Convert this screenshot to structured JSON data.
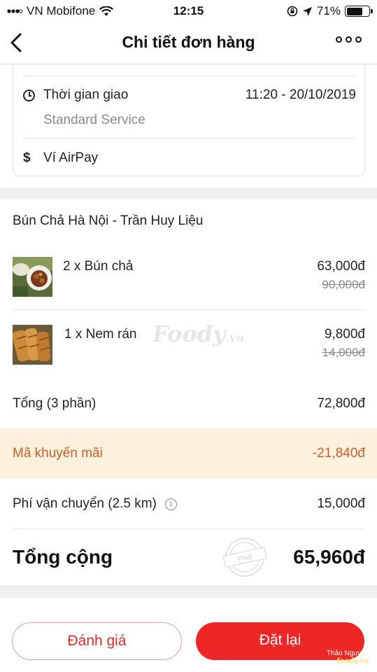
{
  "status_bar": {
    "carrier": "VN Mobifone",
    "time": "12:15",
    "battery": "71%",
    "battery_level": 0.71
  },
  "nav": {
    "title": "Chi tiết đơn hàng",
    "back_icon": "chevron-left-icon",
    "more_icon": "more-dots-icon"
  },
  "delivery": {
    "time_label": "Thời gian giao",
    "time_value": "11:20 - 20/10/2019",
    "service": "Standard Service",
    "payment_symbol": "$",
    "payment_method": "Ví AirPay"
  },
  "order": {
    "restaurant": "Bún Chả Hà Nội - Trần Huy Liệu",
    "items": [
      {
        "name": "2 x Bún chả",
        "price": "63,000đ",
        "old_price": "90,000đ"
      },
      {
        "name": "1 x Nem rán",
        "price": "9,800đ",
        "old_price": "14,000đ"
      }
    ],
    "watermark": "Foody",
    "watermark_suffix": ".vn"
  },
  "summary": {
    "subtotal_label": "Tổng (3 phần)",
    "subtotal_value": "72,800đ",
    "promo_label": "Mã khuyến mãi",
    "promo_value": "-21,840đ",
    "shipping_label": "Phí vận chuyển (2.5 km)",
    "shipping_value": "15,000đ",
    "total_label": "Tổng cộng",
    "total_value": "65,960đ",
    "stamp_text": "Paid"
  },
  "actions": {
    "rate": "Đánh giá",
    "reorder": "Đặt lại"
  },
  "credit": {
    "author": "Thảo Nguyễn",
    "site": "foody.vn"
  },
  "colors": {
    "accent": "#ee2626",
    "promo_bg": "#fdf0dc",
    "promo_text": "#c8602a"
  }
}
